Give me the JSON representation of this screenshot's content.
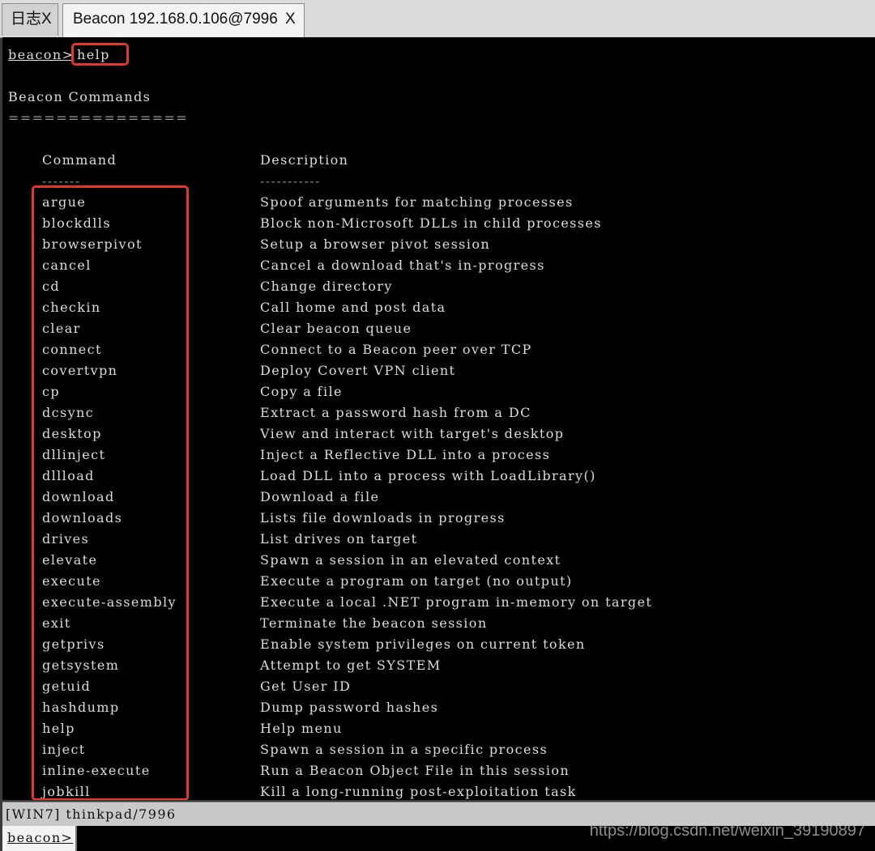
{
  "tabs": [
    {
      "label": "日志X"
    },
    {
      "label": "Beacon 192.168.0.106@7996",
      "close": "X"
    }
  ],
  "console": {
    "prompt": "beacon>",
    "typed_command": "help",
    "heading": "Beacon Commands",
    "heading_rule": "===============",
    "col_command": "Command",
    "col_description": "Description",
    "col_command_rule": "-------",
    "col_description_rule": "-----------",
    "commands": [
      {
        "cmd": "argue",
        "desc": "Spoof arguments for matching processes"
      },
      {
        "cmd": "blockdlls",
        "desc": "Block non-Microsoft DLLs in child processes"
      },
      {
        "cmd": "browserpivot",
        "desc": "Setup a browser pivot session"
      },
      {
        "cmd": "cancel",
        "desc": "Cancel a download that's in-progress"
      },
      {
        "cmd": "cd",
        "desc": "Change directory"
      },
      {
        "cmd": "checkin",
        "desc": "Call home and post data"
      },
      {
        "cmd": "clear",
        "desc": "Clear beacon queue"
      },
      {
        "cmd": "connect",
        "desc": "Connect to a Beacon peer over TCP"
      },
      {
        "cmd": "covertvpn",
        "desc": "Deploy Covert VPN client"
      },
      {
        "cmd": "cp",
        "desc": "Copy a file"
      },
      {
        "cmd": "dcsync",
        "desc": "Extract a password hash from a DC"
      },
      {
        "cmd": "desktop",
        "desc": "View and interact with target's desktop"
      },
      {
        "cmd": "dllinject",
        "desc": "Inject a Reflective DLL into a process"
      },
      {
        "cmd": "dllload",
        "desc": "Load DLL into a process with LoadLibrary()"
      },
      {
        "cmd": "download",
        "desc": "Download a file"
      },
      {
        "cmd": "downloads",
        "desc": "Lists file downloads in progress"
      },
      {
        "cmd": "drives",
        "desc": "List drives on target"
      },
      {
        "cmd": "elevate",
        "desc": "Spawn a session in an elevated context"
      },
      {
        "cmd": "execute",
        "desc": "Execute a program on target (no output)"
      },
      {
        "cmd": "execute-assembly",
        "desc": "Execute a local .NET program in-memory on target"
      },
      {
        "cmd": "exit",
        "desc": "Terminate the beacon session"
      },
      {
        "cmd": "getprivs",
        "desc": "Enable system privileges on current token"
      },
      {
        "cmd": "getsystem",
        "desc": "Attempt to get SYSTEM"
      },
      {
        "cmd": "getuid",
        "desc": "Get User ID"
      },
      {
        "cmd": "hashdump",
        "desc": "Dump password hashes"
      },
      {
        "cmd": "help",
        "desc": "Help menu"
      },
      {
        "cmd": "inject",
        "desc": "Spawn a session in a specific process"
      },
      {
        "cmd": "inline-execute",
        "desc": "Run a Beacon Object File in this session"
      },
      {
        "cmd": "jobkill",
        "desc": "Kill a long-running post-exploitation task"
      }
    ]
  },
  "status": {
    "text": "[WIN7] thinkpad/7996"
  },
  "input": {
    "prompt": "beacon>",
    "value": ""
  },
  "watermark": "https://blog.csdn.net/weixin_39190897",
  "colors": {
    "highlight": "#e0392b",
    "terminal_bg": "#000000"
  }
}
